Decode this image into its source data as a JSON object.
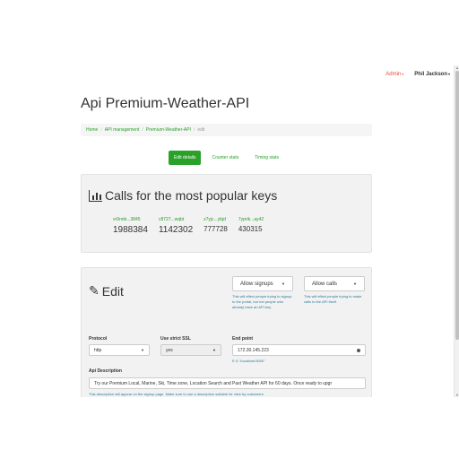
{
  "nav": {
    "admin": "Admin",
    "user": "Phil Jackson"
  },
  "page": {
    "title": "Api Premium-Weather-API"
  },
  "breadcrumb": {
    "home": "Home",
    "management": "API management",
    "api": "Premium-Weather-API",
    "current": "edit"
  },
  "tabs": {
    "edit_details": "Edit details",
    "counter_stats": "Counter stats",
    "timing_stats": "Timing stats"
  },
  "stats": {
    "title": "Calls for the most popular keys",
    "keys": [
      {
        "name": "vr9nnb...3845",
        "count": "1988384"
      },
      {
        "name": "c8727...wqbt",
        "count": "1142302"
      },
      {
        "name": "z7yjc...ybjd",
        "count": "777728"
      },
      {
        "name": "7yprik...ay42",
        "count": "430315"
      }
    ]
  },
  "edit": {
    "title": "Edit",
    "signups": {
      "value": "Allow signups",
      "help": "This will effect people trying to signup to the portal, but not people who already have an API key."
    },
    "calls": {
      "value": "Allow calls",
      "help": "This will effect people trying to make calls to the API itself."
    },
    "protocol": {
      "label": "Protocol",
      "value": "http"
    },
    "ssl": {
      "label": "Use strict SSL",
      "value": "yes"
    },
    "endpoint": {
      "label": "End point",
      "value": "172.30.145.223",
      "hint": "E.G \"localhost:5000\""
    },
    "description": {
      "label": "Api Description",
      "value": "Try our Premium Local, Marine, Ski, Time zone, Location Search and Past Weather API for 60 days. Once ready to upgr",
      "hint": "This description will appear on the signup page. Make sure to use a description suitable for view by customers."
    }
  }
}
